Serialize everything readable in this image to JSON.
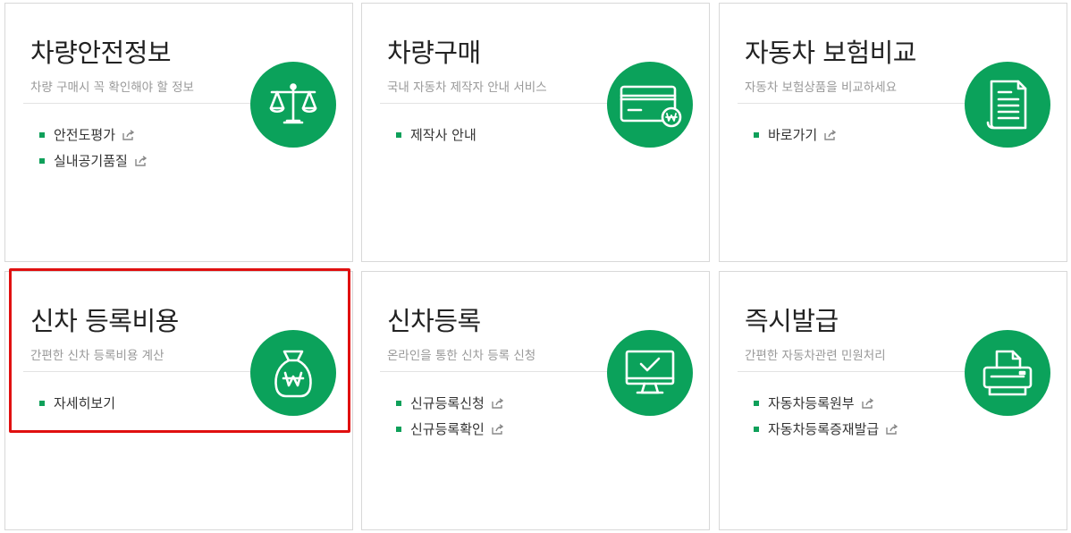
{
  "cards": [
    {
      "title": "차량안전정보",
      "subtitle": "차량 구매시 꼭 확인해야 할 정보",
      "icon": "scale-icon",
      "links": [
        {
          "label": "안전도평가",
          "external": true
        },
        {
          "label": "실내공기품질",
          "external": true
        }
      ]
    },
    {
      "title": "차량구매",
      "subtitle": "국내 자동차 제작자 안내 서비스",
      "icon": "credit-card-won-icon",
      "links": [
        {
          "label": "제작사 안내",
          "external": false
        }
      ]
    },
    {
      "title": "자동차 보험비교",
      "subtitle": "자동차 보험상품을 비교하세요",
      "icon": "document-icon",
      "links": [
        {
          "label": "바로가기",
          "external": true
        }
      ]
    },
    {
      "title": "신차 등록비용",
      "subtitle": "간편한 신차 등록비용 계산",
      "icon": "money-bag-won-icon",
      "links": [
        {
          "label": "자세히보기",
          "external": false
        }
      ]
    },
    {
      "title": "신차등록",
      "subtitle": "온라인을 통한 신차 등록 신청",
      "icon": "monitor-check-icon",
      "links": [
        {
          "label": "신규등록신청",
          "external": true
        },
        {
          "label": "신규등록확인",
          "external": true
        }
      ]
    },
    {
      "title": "즉시발급",
      "subtitle": "간편한 자동차관련 민원처리",
      "icon": "printer-icon",
      "links": [
        {
          "label": "자동차등록원부",
          "external": true
        },
        {
          "label": "자동차등록증재발급",
          "external": true
        }
      ]
    }
  ],
  "colors": {
    "accent": "#0ba25b",
    "highlight": "#e01010"
  }
}
